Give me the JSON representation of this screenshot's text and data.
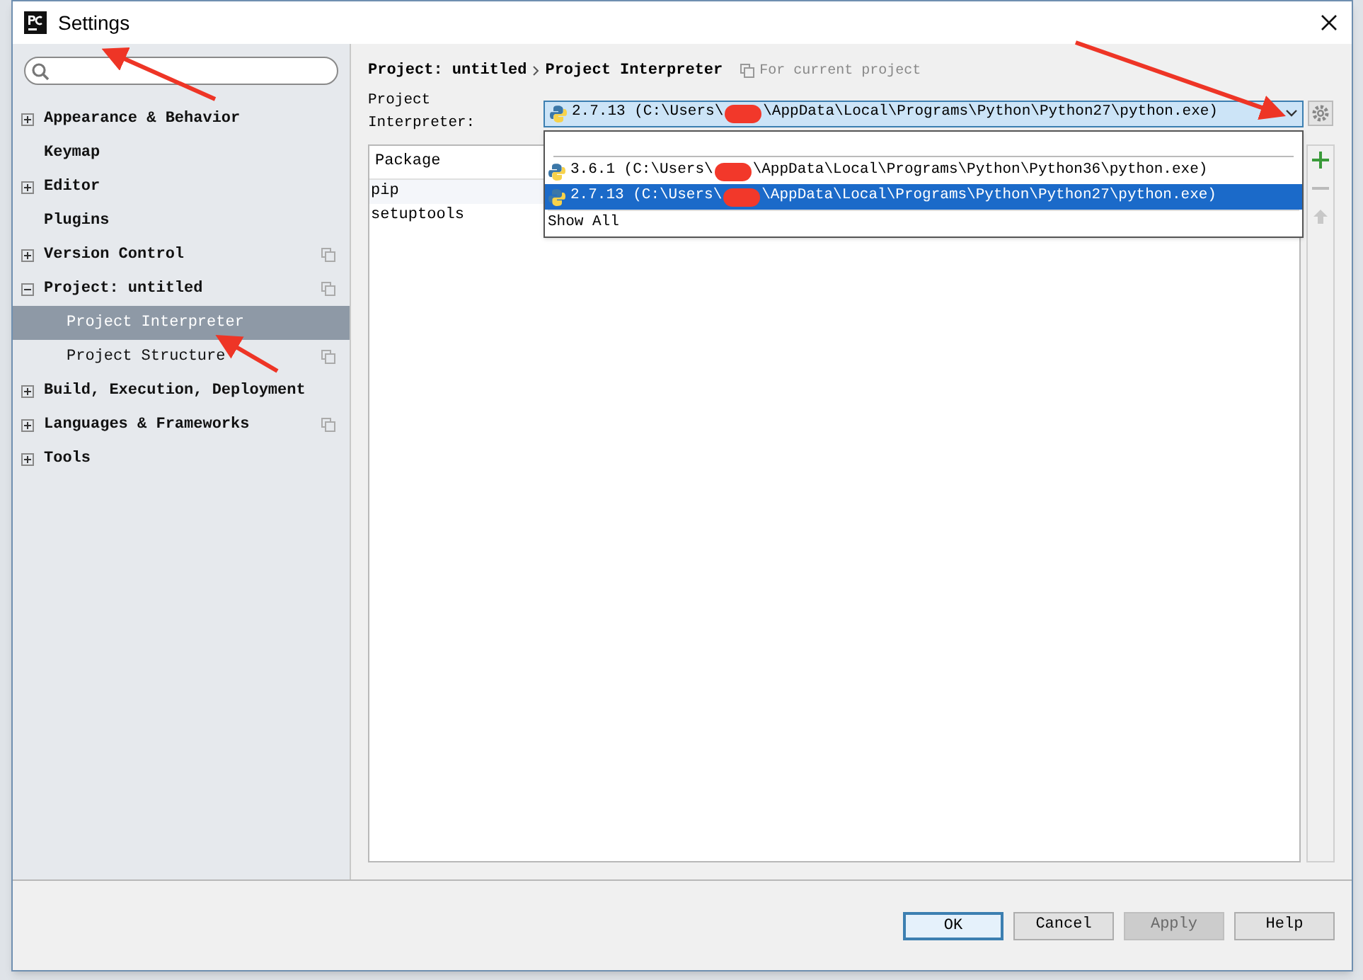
{
  "window": {
    "title": "Settings"
  },
  "sidebar": {
    "items": [
      {
        "label": "Appearance & Behavior",
        "kind": "group",
        "expanded": false,
        "selected": false,
        "copy_icon": false
      },
      {
        "label": "Keymap",
        "kind": "leaf",
        "selected": false,
        "copy_icon": false
      },
      {
        "label": "Editor",
        "kind": "group",
        "expanded": false,
        "selected": false,
        "copy_icon": false
      },
      {
        "label": "Plugins",
        "kind": "leaf",
        "selected": false,
        "copy_icon": false
      },
      {
        "label": "Version Control",
        "kind": "group",
        "expanded": false,
        "selected": false,
        "copy_icon": true
      },
      {
        "label": "Project: untitled",
        "kind": "group",
        "expanded": true,
        "selected": false,
        "copy_icon": true,
        "children": [
          {
            "label": "Project Interpreter",
            "kind": "leaf",
            "selected": true,
            "copy_icon": false
          },
          {
            "label": "Project Structure",
            "kind": "leaf",
            "selected": false,
            "copy_icon": true
          }
        ]
      },
      {
        "label": "Build, Execution, Deployment",
        "kind": "group",
        "expanded": false,
        "selected": false,
        "copy_icon": false
      },
      {
        "label": "Languages & Frameworks",
        "kind": "group",
        "expanded": false,
        "selected": false,
        "copy_icon": true
      },
      {
        "label": "Tools",
        "kind": "group",
        "expanded": false,
        "selected": false,
        "copy_icon": false
      }
    ]
  },
  "breadcrumb": [
    "Project: untitled",
    "Project Interpreter"
  ],
  "scope_note": "For current project",
  "interpreter": {
    "label": "Project Interpreter:",
    "value": {
      "version": "2.7.13",
      "path_start": "(C:\\Users\\",
      "path_end": "\\AppData\\Local\\Programs\\Python\\Python27\\python.exe)"
    },
    "options": [
      {
        "version": "3.6.1",
        "path_start": "(C:\\Users\\",
        "path_end": "\\AppData\\Local\\Programs\\Python\\Python36\\python.exe)",
        "selected": false
      },
      {
        "version": "2.7.13",
        "path_start": "(C:\\Users\\",
        "path_end": "\\AppData\\Local\\Programs\\Python\\Python27\\python.exe)",
        "selected": true
      }
    ],
    "show_all": "Show All"
  },
  "packages": {
    "columns": [
      "Package"
    ],
    "rows": [
      "pip",
      "setuptools"
    ]
  },
  "buttons": [
    {
      "label": "OK",
      "kind": "default",
      "disabled": false
    },
    {
      "label": "Cancel",
      "kind": "normal",
      "disabled": false
    },
    {
      "label": "Apply",
      "kind": "normal",
      "disabled": true
    },
    {
      "label": "Help",
      "kind": "normal",
      "disabled": false
    }
  ]
}
